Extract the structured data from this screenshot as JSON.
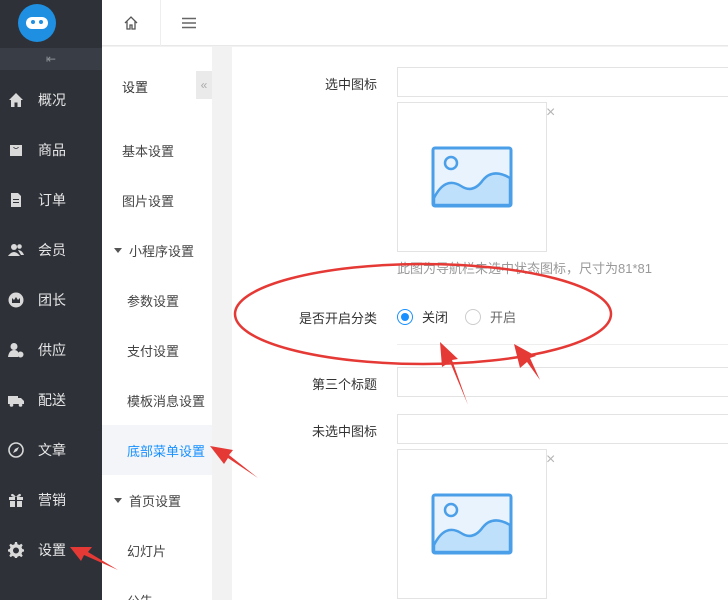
{
  "sidebar": {
    "logo": "logo",
    "collapse_glyph": "⇤",
    "items": [
      {
        "label": "概况",
        "icon": "home-icon"
      },
      {
        "label": "商品",
        "icon": "bag-icon"
      },
      {
        "label": "订单",
        "icon": "document-icon"
      },
      {
        "label": "会员",
        "icon": "users-icon"
      },
      {
        "label": "团长",
        "icon": "crown-icon"
      },
      {
        "label": "供应",
        "icon": "supplier-icon"
      },
      {
        "label": "配送",
        "icon": "truck-icon"
      },
      {
        "label": "文章",
        "icon": "compass-icon"
      },
      {
        "label": "营销",
        "icon": "gift-icon"
      },
      {
        "label": "设置",
        "icon": "gear-icon"
      }
    ]
  },
  "topbar": {
    "home_icon": "home-icon",
    "menu_icon": "menu-icon"
  },
  "subnav": {
    "title": "设置",
    "toggle": "«",
    "items": [
      {
        "label": "基本设置"
      },
      {
        "label": "图片设置"
      },
      {
        "label": "小程序设置"
      },
      {
        "label": "参数设置"
      },
      {
        "label": "支付设置"
      },
      {
        "label": "模板消息设置"
      },
      {
        "label": "底部菜单设置"
      },
      {
        "label": "首页设置"
      },
      {
        "label": "幻灯片"
      },
      {
        "label": "公告"
      }
    ]
  },
  "form": {
    "selected_icon_label": "选中图标",
    "close_glyph": "×",
    "hint": "此图为导航栏未选中状态图标，尺寸为81*81",
    "category_label": "是否开启分类",
    "radio_off": "关闭",
    "radio_on": "开启",
    "radio_selected": "关闭",
    "third_title_label": "第三个标题",
    "unselected_icon_label": "未选中图标"
  },
  "colors": {
    "accent": "#1890ff",
    "sidebar_bg": "#2e3238",
    "annotation_red": "#e53935"
  }
}
